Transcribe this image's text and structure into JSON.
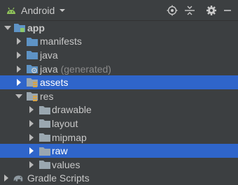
{
  "toolbar": {
    "view_title": "Android",
    "icons": [
      "android-icon",
      "chevron-down-icon",
      "locate-icon",
      "collapse-all-icon",
      "gear-icon",
      "minimize-icon"
    ]
  },
  "tree": {
    "app": "app",
    "manifests": "manifests",
    "java": "java",
    "java_generated": "java",
    "java_generated_suffix": "(generated)",
    "assets": "assets",
    "res": "res",
    "drawable": "drawable",
    "layout": "layout",
    "mipmap": "mipmap",
    "raw": "raw",
    "values": "values",
    "gradle_scripts": "Gradle Scripts"
  },
  "colors": {
    "panel_bg": "#3c3f41",
    "selection": "#2f65ca",
    "folder_blue": "#5e93c5",
    "res_folder_gray": "#9aa7b0",
    "module_green": "#8dc66b",
    "assets_orange": "#d9a343"
  }
}
